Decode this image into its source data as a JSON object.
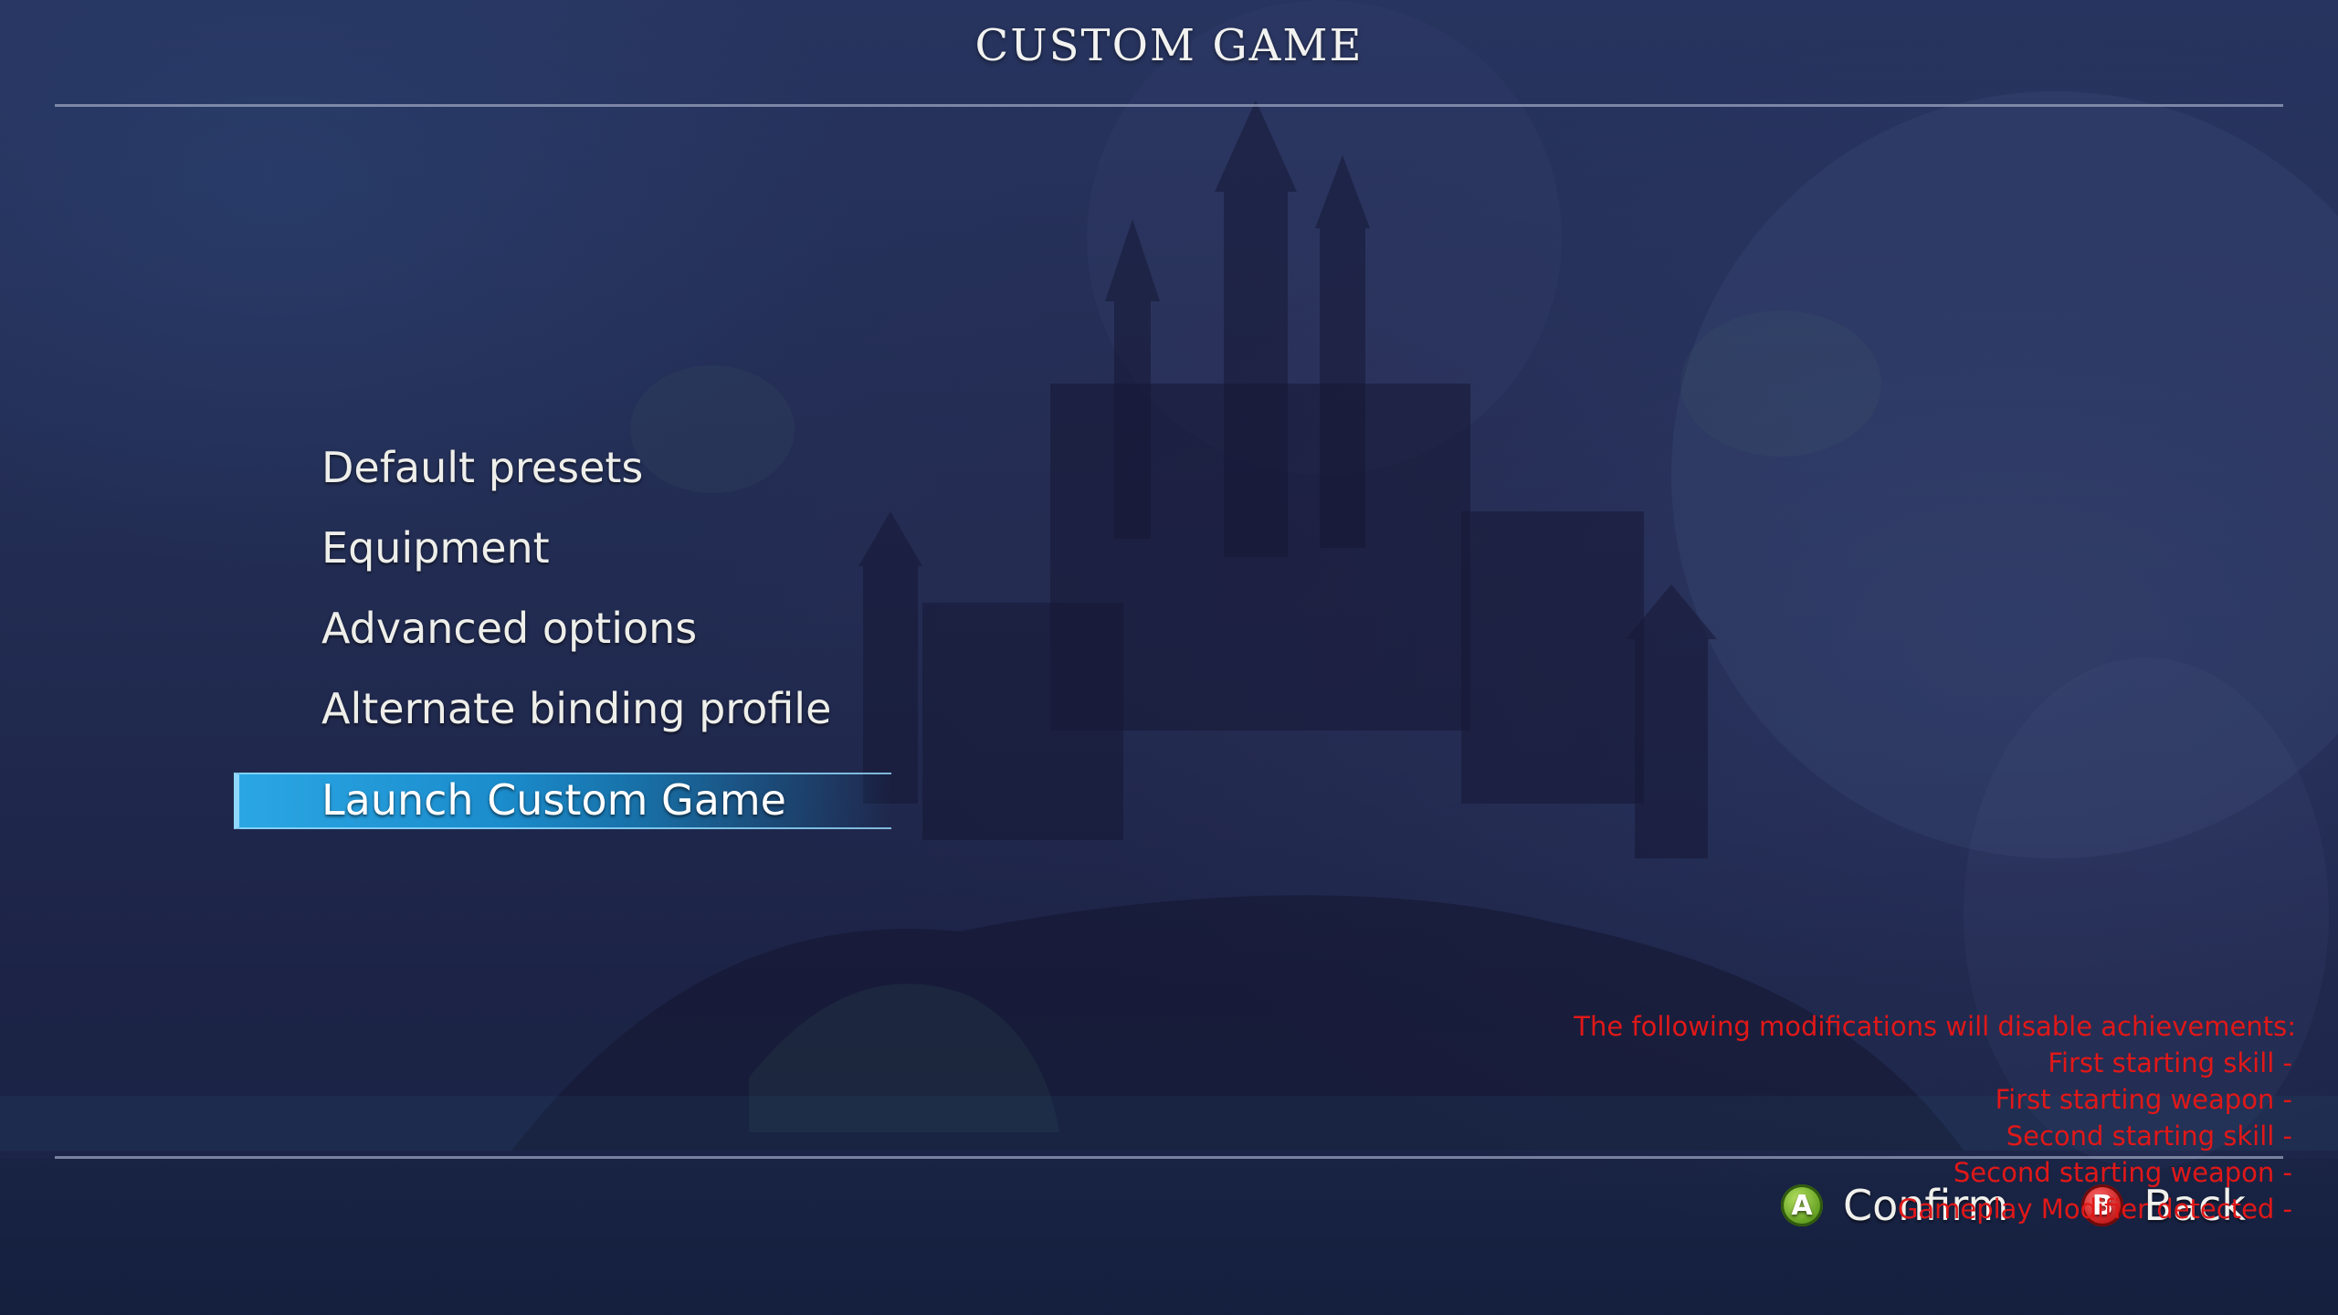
{
  "screen": {
    "title": "CUSTOM GAME"
  },
  "menu": {
    "items": [
      {
        "label": "Default presets",
        "selected": false
      },
      {
        "label": "Equipment",
        "selected": false
      },
      {
        "label": "Advanced options",
        "selected": false
      },
      {
        "label": "Alternate binding profile",
        "selected": false
      },
      {
        "label": "Launch Custom Game",
        "selected": true
      }
    ]
  },
  "warnings": {
    "heading": "The following modifications will disable achievements:",
    "lines": [
      "First starting skill -",
      "First starting weapon -",
      "Second starting skill -",
      "Second starting weapon -",
      "Gameplay Modifier detected -"
    ],
    "color": "#e01818"
  },
  "controls": {
    "confirm": {
      "button": "A",
      "label": "Confirm",
      "icon": "a-button-icon",
      "color": "#6aa824"
    },
    "back": {
      "button": "B",
      "label": "Back",
      "icon": "b-button-icon",
      "color": "#d42020"
    }
  },
  "colors": {
    "accent": "#2ba6e4",
    "background": "#222c52",
    "text": "#eeeeea"
  }
}
